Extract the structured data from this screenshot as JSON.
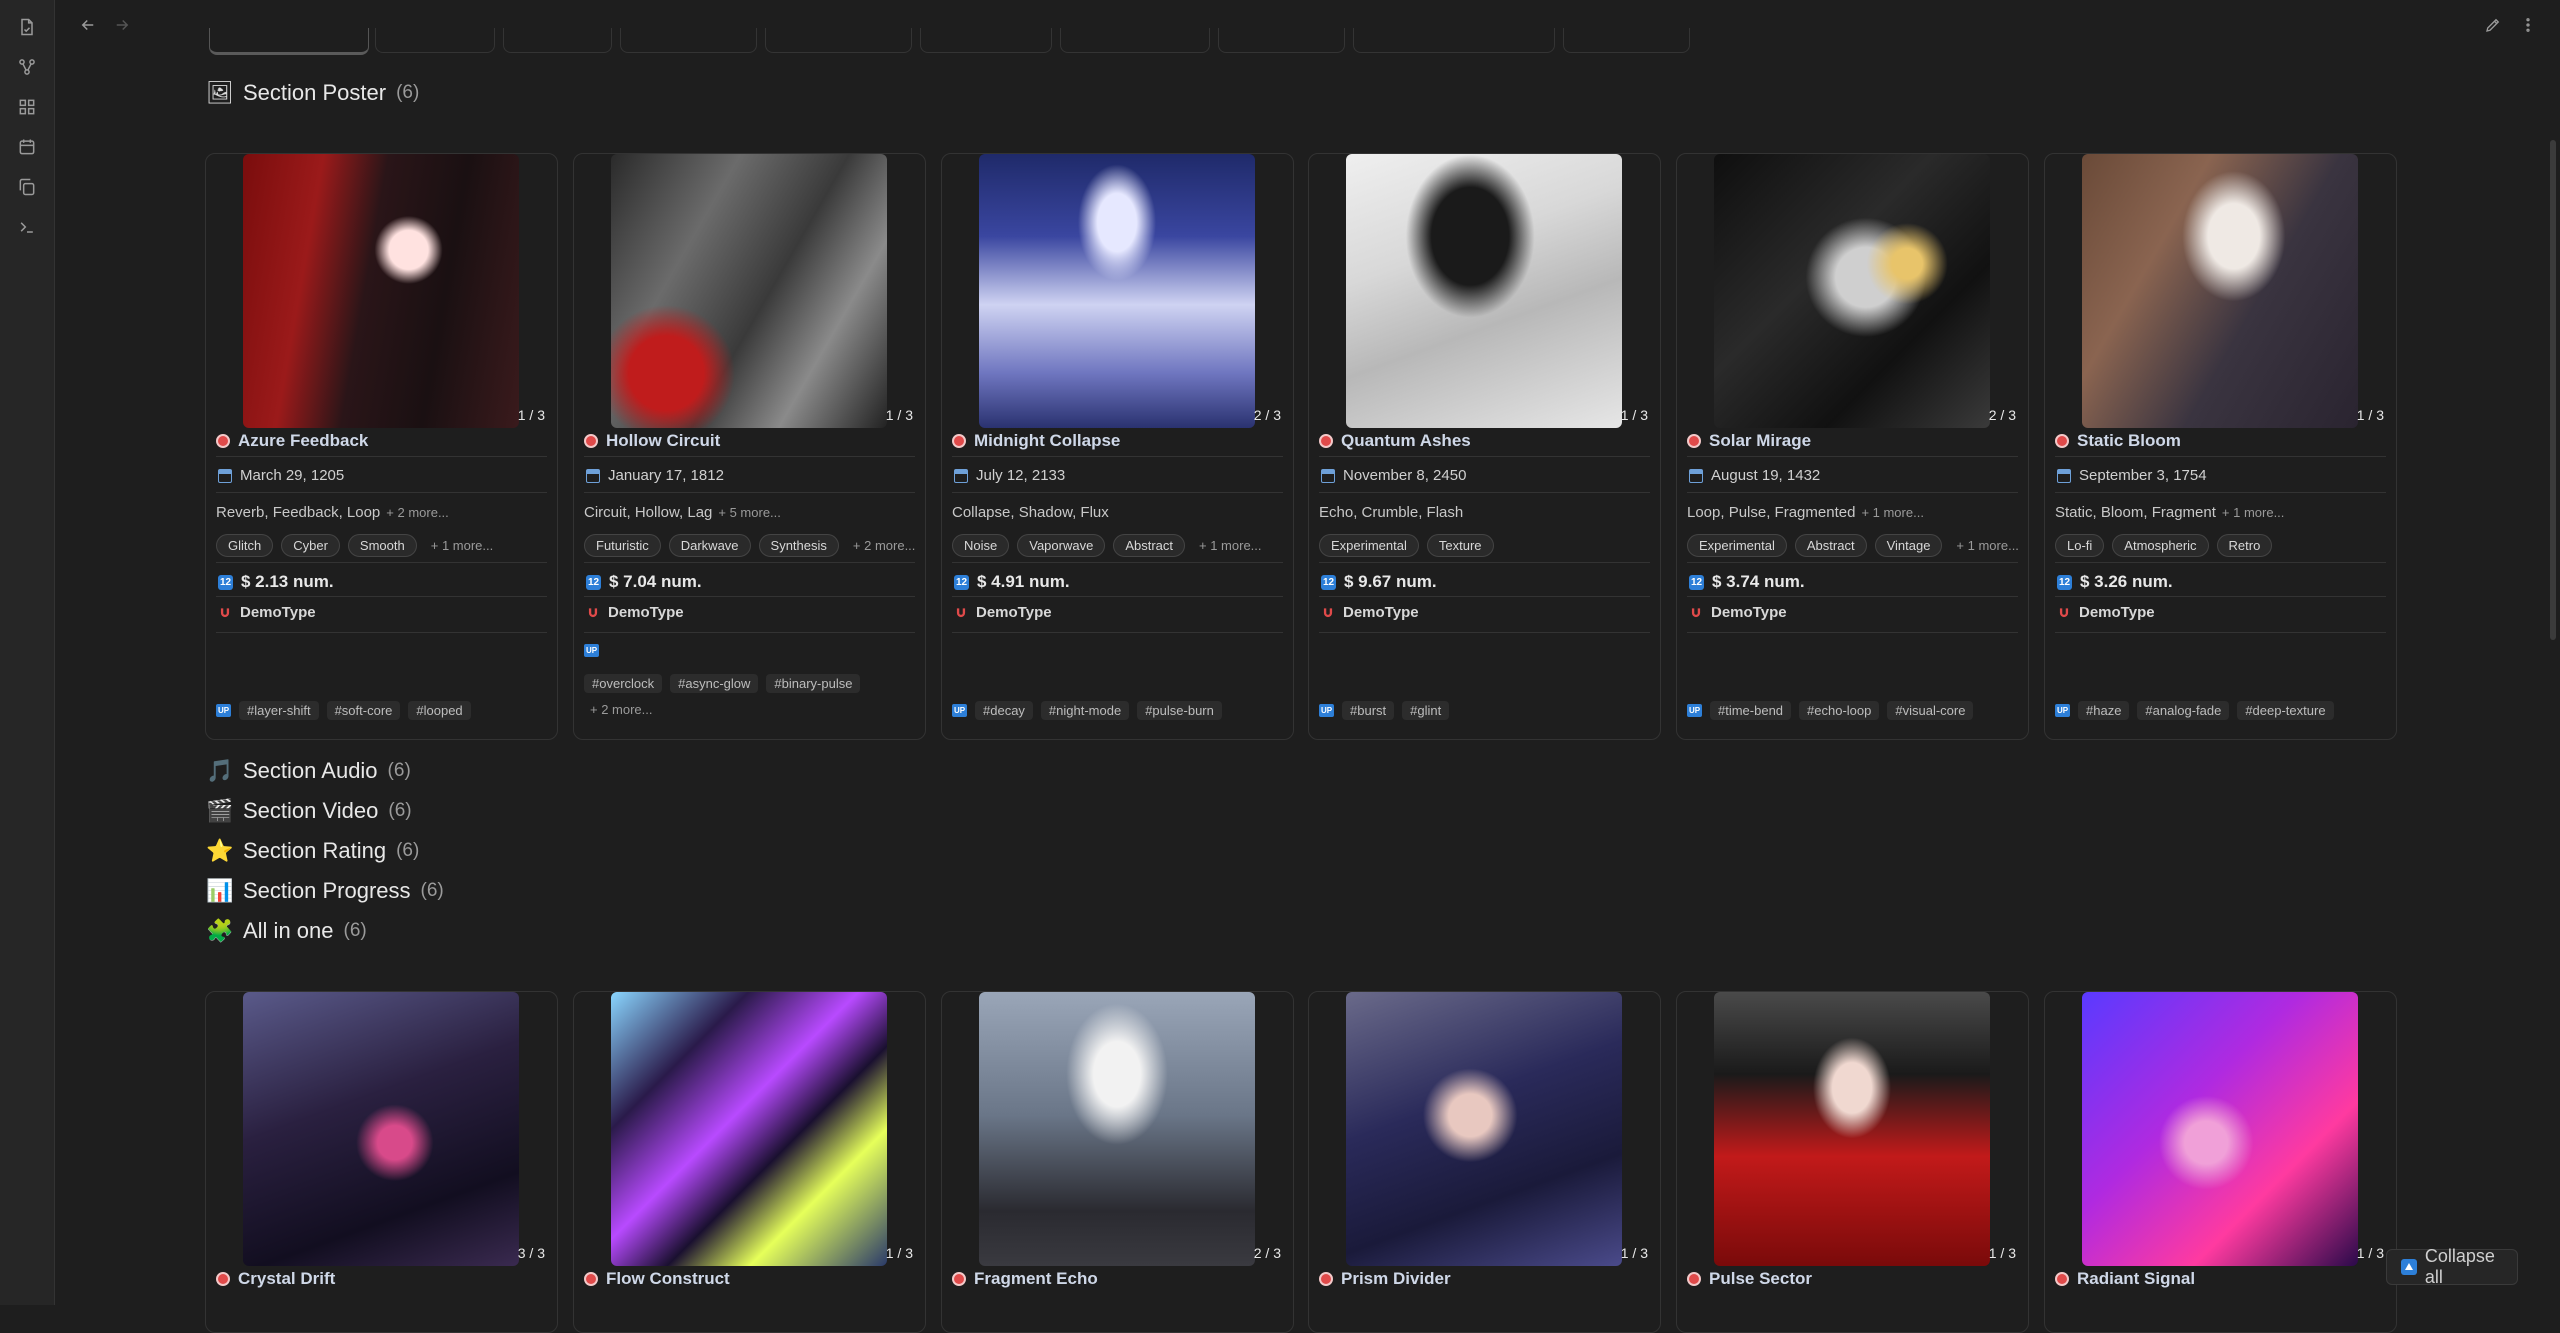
{
  "colors": {
    "accent": "#2d7fd8",
    "background": "#1e1e1e",
    "card_border": "#333333",
    "title_text": "#cfd8e8"
  },
  "ribbon": {
    "icons": [
      "files-icon",
      "graph-icon",
      "grid-icon",
      "calendar-icon",
      "copy-icon",
      "terminal-icon"
    ]
  },
  "nav": {
    "back": "arrow-left-icon",
    "forward": "arrow-right-icon"
  },
  "toolbar": {
    "edit": "pencil-icon",
    "menu": "more-vertical-icon"
  },
  "sections": {
    "poster": {
      "emoji": "🖼",
      "title": "Section Poster",
      "count": "(6)"
    },
    "audio": {
      "emoji": "🎵",
      "title": "Section Audio",
      "count": "(6)"
    },
    "video": {
      "emoji": "🎬",
      "title": "Section Video",
      "count": "(6)"
    },
    "rating": {
      "emoji": "⭐",
      "title": "Section Rating",
      "count": "(6)"
    },
    "progress": {
      "emoji": "📊",
      "title": "Section Progress",
      "count": "(6)"
    },
    "allinone": {
      "emoji": "🧩",
      "title": "All in one",
      "count": "(6)"
    }
  },
  "poster_cards": [
    {
      "title": "Azure Feedback",
      "pager": "1 / 3",
      "date": "March 29, 1205",
      "genres": "Reverb, Feedback, Loop",
      "genres_more": "+ 2 more...",
      "chips": [
        "Glitch",
        "Cyber",
        "Smooth"
      ],
      "chips_more": "+ 1 more...",
      "price": "$ 2.13 num.",
      "brand": "DemoType",
      "tags": [
        "#layer-shift",
        "#soft-core",
        "#looped"
      ],
      "tags_more": ""
    },
    {
      "title": "Hollow Circuit",
      "pager": "1 / 3",
      "date": "January 17, 1812",
      "genres": "Circuit, Hollow, Lag",
      "genres_more": "+ 5 more...",
      "chips": [
        "Futuristic",
        "Darkwave",
        "Synthesis"
      ],
      "chips_more": "+ 2 more...",
      "price": "$ 7.04 num.",
      "brand": "DemoType",
      "tags": [
        "#overclock",
        "#async-glow",
        "#binary-pulse"
      ],
      "tags_more": "+ 2 more..."
    },
    {
      "title": "Midnight Collapse",
      "pager": "2 / 3",
      "date": "July 12, 2133",
      "genres": "Collapse, Shadow, Flux",
      "genres_more": "",
      "chips": [
        "Noise",
        "Vaporwave",
        "Abstract"
      ],
      "chips_more": "+ 1 more...",
      "price": "$ 4.91 num.",
      "brand": "DemoType",
      "tags": [
        "#decay",
        "#night-mode",
        "#pulse-burn"
      ],
      "tags_more": ""
    },
    {
      "title": "Quantum Ashes",
      "pager": "1 / 3",
      "date": "November 8, 2450",
      "genres": "Echo, Crumble, Flash",
      "genres_more": "",
      "chips": [
        "Experimental",
        "Texture"
      ],
      "chips_more": "",
      "price": "$ 9.67 num.",
      "brand": "DemoType",
      "tags": [
        "#burst",
        "#glint"
      ],
      "tags_more": ""
    },
    {
      "title": "Solar Mirage",
      "pager": "2 / 3",
      "date": "August 19, 1432",
      "genres": "Loop, Pulse, Fragmented",
      "genres_more": "+ 1 more...",
      "chips": [
        "Experimental",
        "Abstract",
        "Vintage"
      ],
      "chips_more": "+ 1 more...",
      "price": "$ 3.74 num.",
      "brand": "DemoType",
      "tags": [
        "#time-bend",
        "#echo-loop",
        "#visual-core"
      ],
      "tags_more": ""
    },
    {
      "title": "Static Bloom",
      "pager": "1 / 3",
      "date": "September 3, 1754",
      "genres": "Static, Bloom, Fragment",
      "genres_more": "+ 1 more...",
      "chips": [
        "Lo-fi",
        "Atmospheric",
        "Retro"
      ],
      "chips_more": "",
      "price": "$ 3.26 num.",
      "brand": "DemoType",
      "tags": [
        "#haze",
        "#analog-fade",
        "#deep-texture"
      ],
      "tags_more": ""
    }
  ],
  "allinone_cards": [
    {
      "title": "Crystal Drift",
      "pager": "3 / 3"
    },
    {
      "title": "Flow Construct",
      "pager": "1 / 3"
    },
    {
      "title": "Fragment Echo",
      "pager": "2 / 3"
    },
    {
      "title": "Prism Divider",
      "pager": "1 / 3"
    },
    {
      "title": "Pulse Sector",
      "pager": "1 / 3"
    },
    {
      "title": "Radiant Signal",
      "pager": "1 / 3"
    }
  ],
  "collapse_all": "Collapse all"
}
